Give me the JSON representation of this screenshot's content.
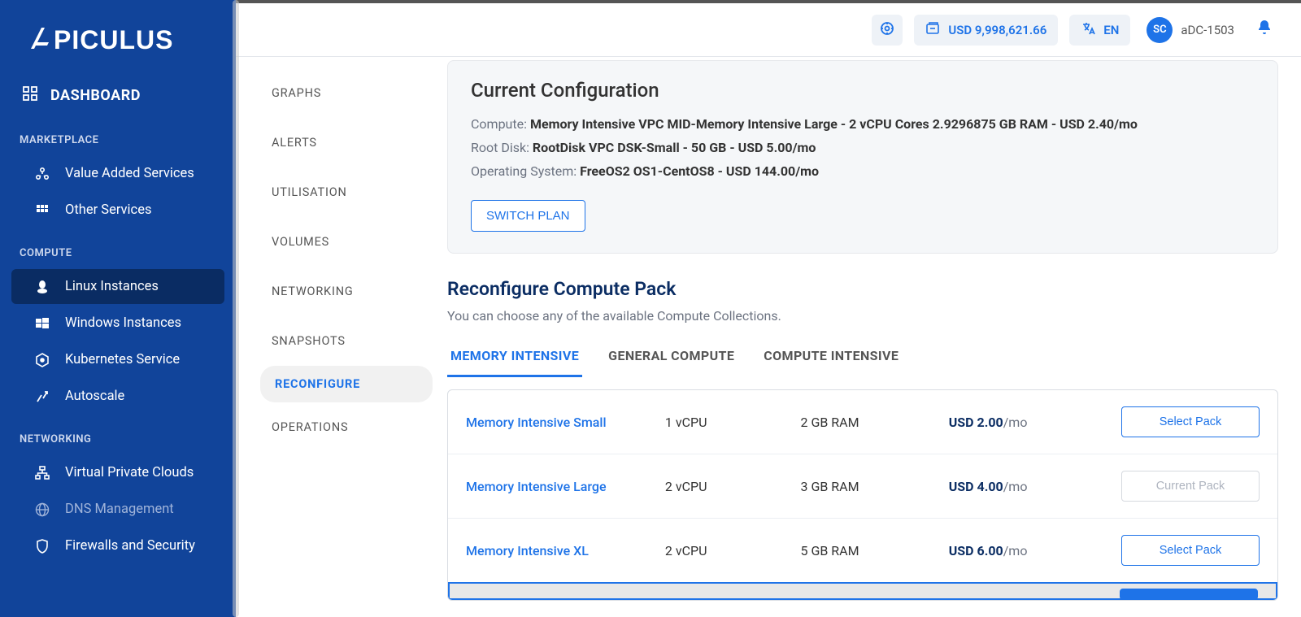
{
  "brand": "APICULUS",
  "topbar": {
    "balance": "USD 9,998,621.66",
    "lang": "EN",
    "avatar_initials": "SC",
    "account_id": "aDC-1503"
  },
  "sidebar": {
    "dashboard_label": "DASHBOARD",
    "sections": {
      "marketplace": {
        "label": "MARKETPLACE",
        "items": [
          {
            "id": "vas",
            "label": "Value Added Services"
          },
          {
            "id": "other",
            "label": "Other Services"
          }
        ]
      },
      "compute": {
        "label": "COMPUTE",
        "items": [
          {
            "id": "linux",
            "label": "Linux Instances",
            "active": true
          },
          {
            "id": "windows",
            "label": "Windows Instances"
          },
          {
            "id": "k8s",
            "label": "Kubernetes Service"
          },
          {
            "id": "autoscale",
            "label": "Autoscale"
          }
        ]
      },
      "networking": {
        "label": "NETWORKING",
        "items": [
          {
            "id": "vpc",
            "label": "Virtual Private Clouds"
          },
          {
            "id": "dns",
            "label": "DNS Management",
            "muted": true
          },
          {
            "id": "fw",
            "label": "Firewalls and Security"
          }
        ]
      }
    }
  },
  "subnav": {
    "items": [
      {
        "id": "graphs",
        "label": "GRAPHS"
      },
      {
        "id": "alerts",
        "label": "ALERTS"
      },
      {
        "id": "utilisation",
        "label": "UTILISATION"
      },
      {
        "id": "volumes",
        "label": "VOLUMES"
      },
      {
        "id": "networking",
        "label": "NETWORKING"
      },
      {
        "id": "snapshots",
        "label": "SNAPSHOTS"
      },
      {
        "id": "reconfigure",
        "label": "RECONFIGURE",
        "active": true
      },
      {
        "id": "operations",
        "label": "OPERATIONS"
      }
    ]
  },
  "config": {
    "title": "Current Configuration",
    "rows": {
      "compute_label": "Compute: ",
      "compute_value": "Memory Intensive VPC MID-Memory Intensive Large - 2 vCPU Cores 2.9296875 GB RAM - USD 2.40/mo",
      "root_label": "Root Disk: ",
      "root_value": "RootDisk VPC DSK-Small - 50 GB - USD 5.00/mo",
      "os_label": "Operating System: ",
      "os_value": "FreeOS2 OS1-CentOS8 - USD 144.00/mo"
    },
    "switch_btn": "SWITCH PLAN"
  },
  "reconfigure": {
    "title": "Reconfigure Compute Pack",
    "desc": "You can choose any of the available Compute Collections.",
    "tabs": [
      {
        "id": "memory",
        "label": "MEMORY INTENSIVE",
        "active": true
      },
      {
        "id": "general",
        "label": "GENERAL COMPUTE"
      },
      {
        "id": "compute",
        "label": "COMPUTE INTENSIVE"
      }
    ],
    "buttons": {
      "select": "Select Pack",
      "current": "Current Pack"
    },
    "packs": [
      {
        "name": "Memory Intensive Small",
        "cpu": "1 vCPU",
        "ram": "2 GB RAM",
        "price": "USD 2.00",
        "per": "/mo",
        "state": "select"
      },
      {
        "name": "Memory Intensive Large",
        "cpu": "2 vCPU",
        "ram": "3 GB RAM",
        "price": "USD 4.00",
        "per": "/mo",
        "state": "current"
      },
      {
        "name": "Memory Intensive XL",
        "cpu": "2 vCPU",
        "ram": "5 GB RAM",
        "price": "USD 6.00",
        "per": "/mo",
        "state": "select"
      }
    ]
  }
}
